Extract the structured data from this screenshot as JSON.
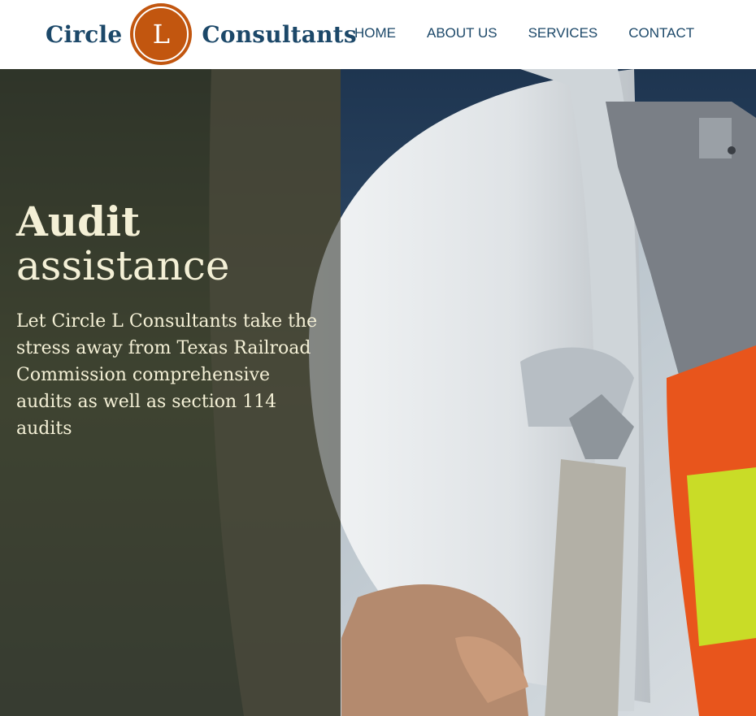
{
  "header": {
    "logo": {
      "word_left": "Circle",
      "letter": "L",
      "word_right": "Consultants"
    },
    "nav": [
      {
        "label": "HOME"
      },
      {
        "label": "ABOUT US"
      },
      {
        "label": "SERVICES"
      },
      {
        "label": "CONTACT"
      }
    ]
  },
  "hero": {
    "title_line1": "Audit",
    "title_line2": "assistance",
    "description": "Let Circle L Consultants take the stress away from Texas Railroad Commission comprehensive audits as well as section 114 audits",
    "image_subject": "hard-hat-safety-vest-photo"
  },
  "colors": {
    "brand_navy": "#1c4869",
    "brand_orange": "#c2560f",
    "hero_text": "#f4f0d6"
  }
}
